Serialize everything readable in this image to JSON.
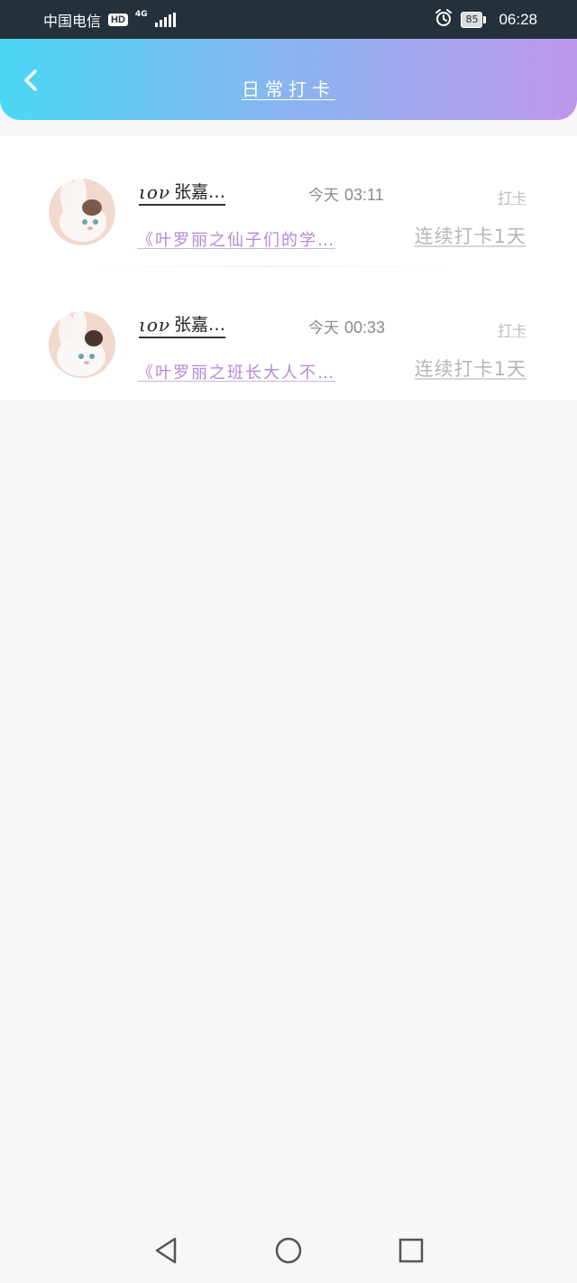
{
  "status_bar": {
    "carrier": "中国电信",
    "hd": "HD",
    "network": "4G",
    "battery": "85",
    "time": "06:28",
    "icons": [
      "hd-icon",
      "signal-icon",
      "alarm-icon",
      "battery-icon"
    ]
  },
  "header": {
    "title": "日常打卡",
    "back_icon": "chevron-left-icon",
    "gradient": [
      "#4ad7f6",
      "#8ab4f0",
      "#bd96ea"
    ]
  },
  "entries": [
    {
      "user_deco": "ιον",
      "user_name": "张嘉…",
      "day": "今天",
      "time": "03:11",
      "tag": "打卡",
      "book": "《叶罗丽之仙子们的学…",
      "streak": "连续打卡1天",
      "avatar": "avatar-bunny-1"
    },
    {
      "user_deco": "ιον",
      "user_name": "张嘉…",
      "day": "今天",
      "time": "00:33",
      "tag": "打卡",
      "book": "《叶罗丽之班长大人不…",
      "streak": "连续打卡1天",
      "avatar": "avatar-bunny-2"
    }
  ],
  "nav_bar": {
    "icons": [
      "back-triangle-icon",
      "home-circle-icon",
      "recents-square-icon"
    ]
  },
  "colors": {
    "accent_purple": "#b489d8",
    "status_bar_bg": "#24313b",
    "page_bg": "#f8f6f7"
  }
}
